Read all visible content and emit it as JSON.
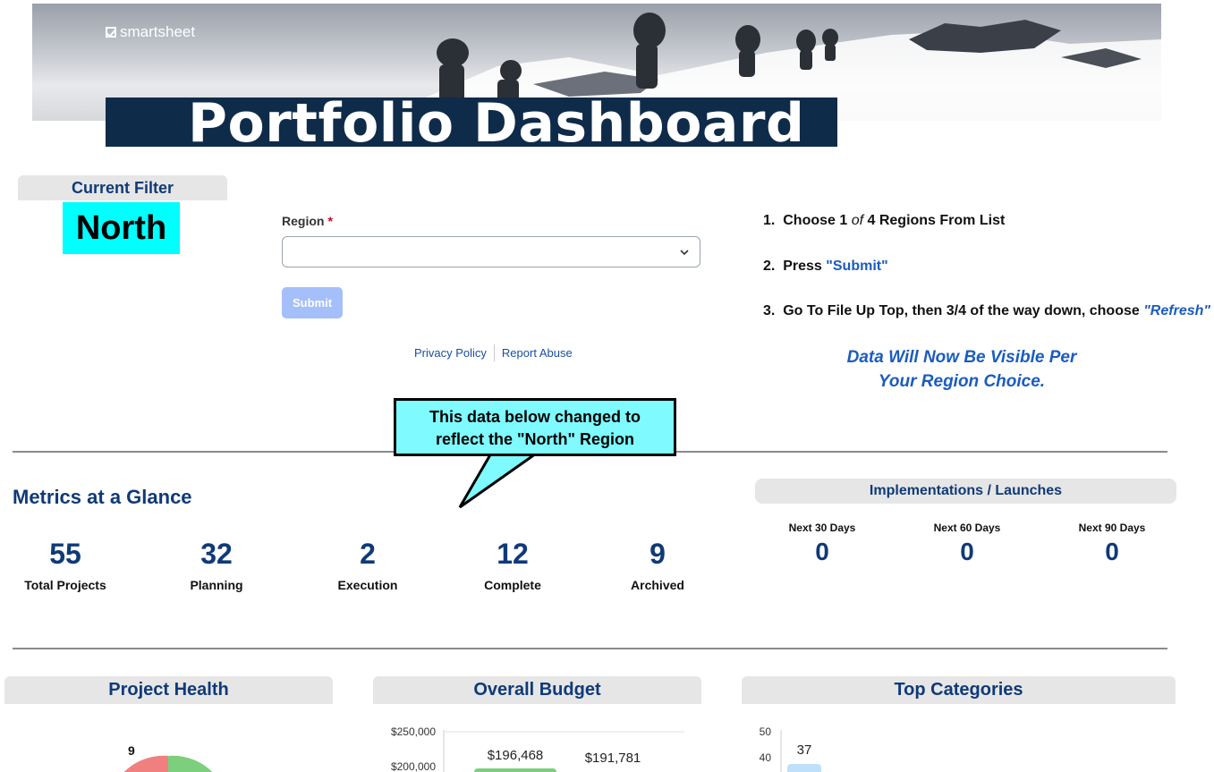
{
  "banner": {
    "logo_text": "smartsheet",
    "title": "Portfolio Dashboard"
  },
  "current_filter": {
    "header": "Current Filter",
    "value": "North"
  },
  "form": {
    "region_label": "Region",
    "required_mark": "*",
    "region_value": "",
    "submit_label": "Submit",
    "links": [
      "Privacy Policy",
      "Report Abuse"
    ]
  },
  "steps": {
    "s1_num": "1.",
    "s1_a": "Choose 1 ",
    "s1_b": "of",
    "s1_c": " 4 Regions From List",
    "s2_num": "2.",
    "s2_a": "Press ",
    "s2_b": "\"Submit\"",
    "s3_num": "3.",
    "s3_a": "Go To File Up Top, then 3/4 of the way down, choose ",
    "s3_b": "\"Refresh\"",
    "notice_line1": "Data Will Now Be Visible Per",
    "notice_line2": "Your Region Choice."
  },
  "callout": {
    "line1": "This data below changed to",
    "line2": "reflect the \"North\" Region"
  },
  "metrics": {
    "title": "Metrics at a Glance",
    "items": [
      {
        "value": "55",
        "label": "Total Projects"
      },
      {
        "value": "32",
        "label": "Planning"
      },
      {
        "value": "2",
        "label": "Execution"
      },
      {
        "value": "12",
        "label": "Complete"
      },
      {
        "value": "9",
        "label": "Archived"
      }
    ]
  },
  "implementations": {
    "title": "Implementations / Launches",
    "items": [
      {
        "label": "Next 30 Days",
        "value": "0"
      },
      {
        "label": "Next 60 Days",
        "value": "0"
      },
      {
        "label": "Next 90 Days",
        "value": "0"
      }
    ]
  },
  "panels": {
    "project_health": "Project Health",
    "overall_budget": "Overall Budget",
    "top_categories": "Top Categories"
  },
  "colors": {
    "navy": "#0f2b4a",
    "heading_blue": "#0f3a78",
    "link_blue": "#1a5cbf",
    "filter_highlight": "#00ffff",
    "submit_disabled": "#a4bff9",
    "pie_red": "#f08080",
    "pie_green": "#7ccf7c"
  },
  "chart_data": [
    {
      "type": "pie",
      "title": "Project Health",
      "data_labels": [
        "9"
      ],
      "visible_note": "only the top of the pie is visible"
    },
    {
      "type": "bar",
      "title": "Overall Budget",
      "y_ticks": [
        "$250,000",
        "$200,000"
      ],
      "data_labels": [
        "$196,468",
        "$191,781"
      ],
      "values": [
        196468,
        191781
      ]
    },
    {
      "type": "bar",
      "title": "Top Categories",
      "y_ticks": [
        "50",
        "40"
      ],
      "data_labels": [
        "37"
      ],
      "values": [
        37
      ]
    }
  ]
}
